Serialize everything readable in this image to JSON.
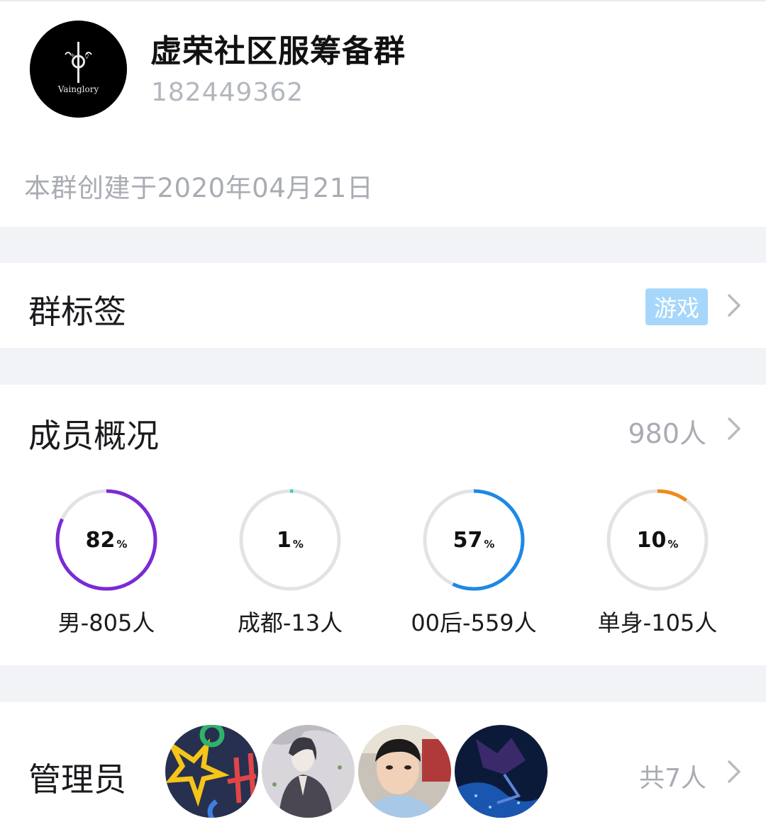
{
  "header": {
    "group_name": "虚荣社区服筹备群",
    "group_id": "182449362",
    "avatar_text": "Vainglory",
    "created_text": "本群创建于2020年04月21日"
  },
  "tags": {
    "title": "群标签",
    "tag": "游戏",
    "tag_color": "#a6d7fb"
  },
  "members": {
    "title": "成员概况",
    "count": "980人",
    "stats": [
      {
        "value": "82",
        "unit": "%",
        "percent": 82,
        "color": "#7b2ad6",
        "label": "男-805人"
      },
      {
        "value": "1",
        "unit": "%",
        "percent": 1,
        "color": "#3fcfb4",
        "label": "成都-13人"
      },
      {
        "value": "57",
        "unit": "%",
        "percent": 57,
        "color": "#1e88e5",
        "label": "00后-559人"
      },
      {
        "value": "10",
        "unit": "%",
        "percent": 10,
        "color": "#f08a1c",
        "label": "单身-105人"
      }
    ]
  },
  "admins": {
    "title": "管理员",
    "count": "共7人",
    "avatars": [
      "avatar-letters-icon",
      "avatar-ink-portrait-icon",
      "avatar-selfie-icon",
      "avatar-mecha-icon"
    ]
  }
}
